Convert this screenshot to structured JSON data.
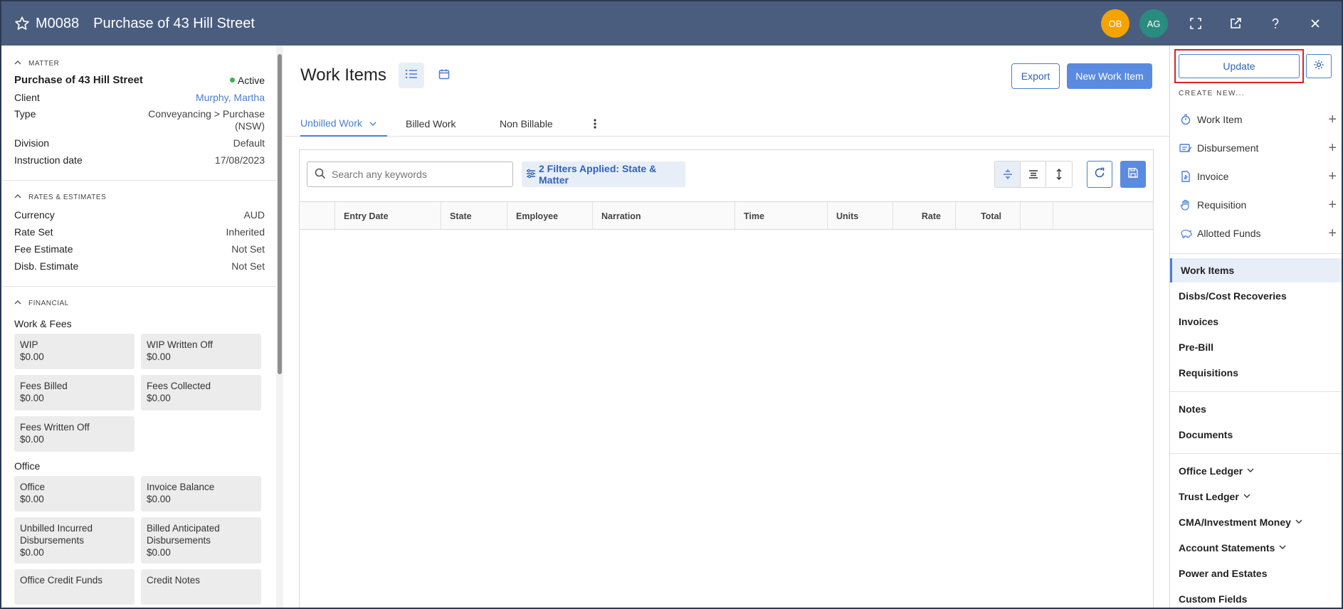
{
  "header": {
    "matter_code": "M0088",
    "title": "Purchase of 43 Hill Street",
    "avatars": [
      {
        "initials": "OB",
        "color": "#f4a300"
      },
      {
        "initials": "AG",
        "color": "#2a8c7e"
      }
    ],
    "icons": [
      "star-icon",
      "fullscreen-icon",
      "external-link-icon",
      "help-icon",
      "close-icon"
    ]
  },
  "matter": {
    "section_label": "MATTER",
    "name": "Purchase of 43 Hill Street",
    "status": "Active",
    "fields": [
      {
        "label": "Client",
        "value": "Murphy, Martha"
      },
      {
        "label": "Type",
        "value": "Conveyancing > Purchase (NSW)"
      },
      {
        "label": "Division",
        "value": "Default"
      },
      {
        "label": "Instruction date",
        "value": "17/08/2023"
      }
    ]
  },
  "rates": {
    "section_label": "RATES & ESTIMATES",
    "fields": [
      {
        "label": "Currency",
        "value": "AUD"
      },
      {
        "label": "Rate Set",
        "value": "Inherited"
      },
      {
        "label": "Fee Estimate",
        "value": "Not Set"
      },
      {
        "label": "Disb. Estimate",
        "value": "Not Set"
      }
    ]
  },
  "financial": {
    "section_label": "FINANCIAL",
    "work_fees_label": "Work & Fees",
    "work_fees": [
      {
        "label": "WIP",
        "value": "$0.00"
      },
      {
        "label": "WIP Written Off",
        "value": "$0.00"
      },
      {
        "label": "Fees Billed",
        "value": "$0.00"
      },
      {
        "label": "Fees Collected",
        "value": "$0.00"
      },
      {
        "label": "Fees Written Off",
        "value": "$0.00"
      }
    ],
    "office_label": "Office",
    "office": [
      {
        "label": "Office",
        "value": "$0.00"
      },
      {
        "label": "Invoice Balance",
        "value": "$0.00"
      },
      {
        "label": "Unbilled Incurred Disbursements",
        "value": "$0.00"
      },
      {
        "label": "Billed Anticipated Disbursements",
        "value": "$0.00"
      },
      {
        "label": "Office Credit Funds",
        "value": ""
      },
      {
        "label": "Credit Notes",
        "value": ""
      }
    ]
  },
  "main": {
    "title": "Work Items",
    "export_label": "Export",
    "new_label": "New Work Item",
    "tabs": [
      {
        "label": "Unbilled Work"
      },
      {
        "label": "Billed Work"
      },
      {
        "label": "Non Billable"
      }
    ],
    "search": {
      "placeholder": "Search any keywords",
      "value": ""
    },
    "filter_label": "2 Filters Applied: State & Matter",
    "columns": [
      "Entry Date",
      "State",
      "Employee",
      "Narration",
      "Time",
      "Units",
      "Rate",
      "Total"
    ]
  },
  "right": {
    "update_label": "Update",
    "create_label": "CREATE NEW...",
    "create_items": [
      {
        "label": "Work Item",
        "icon": "stopwatch-icon"
      },
      {
        "label": "Disbursement",
        "icon": "disbursement-icon"
      },
      {
        "label": "Invoice",
        "icon": "invoice-icon"
      },
      {
        "label": "Requisition",
        "icon": "hand-icon"
      },
      {
        "label": "Allotted Funds",
        "icon": "piggy-bank-icon"
      }
    ],
    "nav_group1": [
      "Work Items",
      "Disbs/Cost Recoveries",
      "Invoices",
      "Pre-Bill",
      "Requisitions"
    ],
    "nav_group2": [
      "Notes",
      "Documents"
    ],
    "nav_group3": [
      "Office Ledger",
      "Trust Ledger",
      "CMA/Investment Money",
      "Account Statements",
      "Power and Estates",
      "Custom Fields"
    ],
    "accent": "#4a7fd0"
  }
}
